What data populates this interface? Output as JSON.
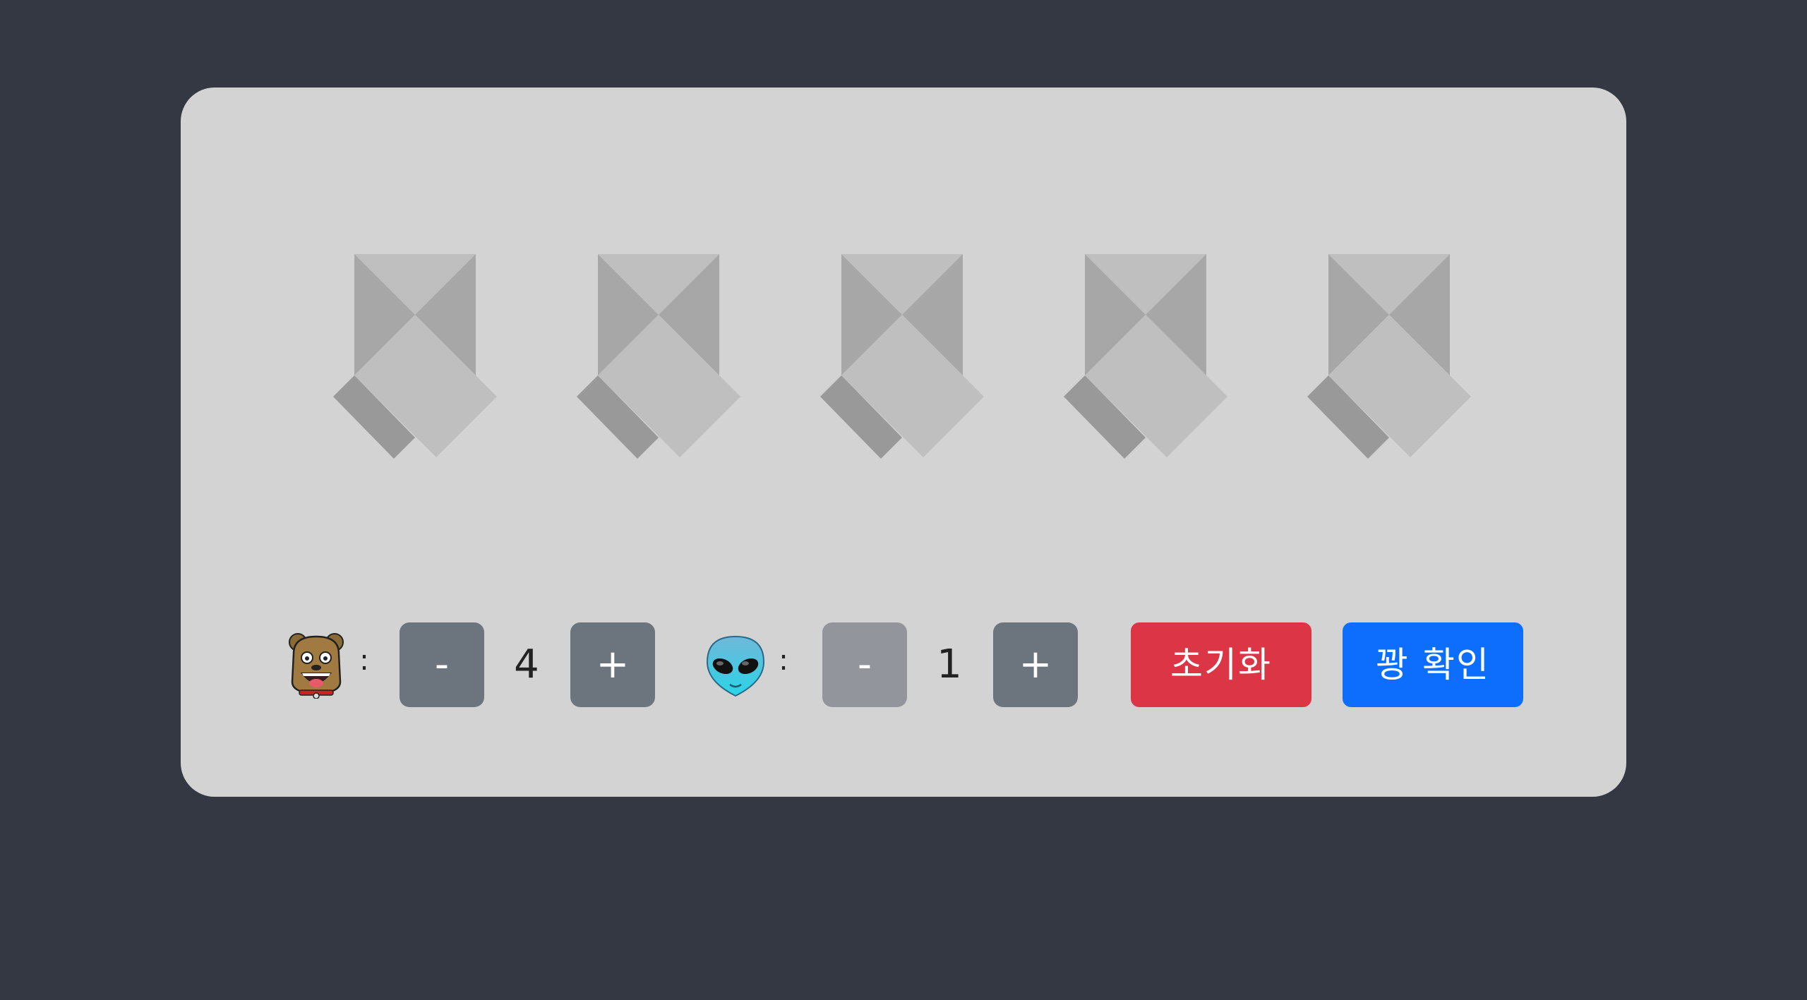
{
  "colors": {
    "background": "#343842",
    "card": "#d3d3d3",
    "ribbon_light": "#bfbfbf",
    "ribbon_mid": "#a7a7a7",
    "ribbon_dark": "#999999",
    "step_button": "#6c757d",
    "step_button_disabled": "#92969c",
    "reset_button": "#dc3545",
    "confirm_button": "#0d6efd"
  },
  "ribbons": [
    {
      "icon": "ribbon-icon"
    },
    {
      "icon": "ribbon-icon"
    },
    {
      "icon": "ribbon-icon"
    },
    {
      "icon": "ribbon-icon"
    },
    {
      "icon": "ribbon-icon"
    }
  ],
  "players": [
    {
      "icon": "bulldog-face-icon",
      "separator": ":",
      "minus_label": "-",
      "count": "4",
      "plus_label": "+",
      "minus_enabled": true
    },
    {
      "icon": "alien-face-icon",
      "separator": ":",
      "minus_label": "-",
      "count": "1",
      "plus_label": "+",
      "minus_enabled": false
    }
  ],
  "actions": {
    "reset_label": "초기화",
    "confirm_label": "꽝 확인"
  }
}
